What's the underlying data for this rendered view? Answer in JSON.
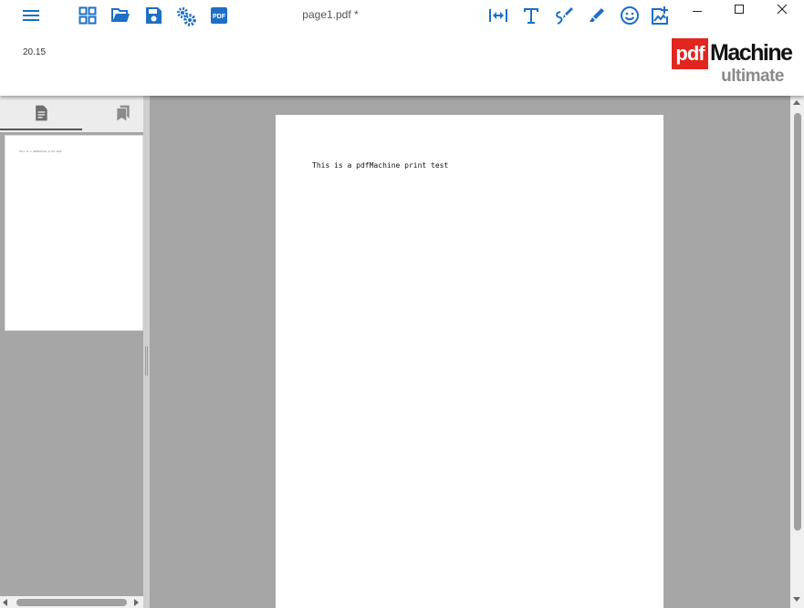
{
  "app": {
    "document_title": "page1.pdf *",
    "version": "20.15"
  },
  "logo": {
    "box_text": "pdf",
    "name": "Machine",
    "edition": "ultimate"
  },
  "toolbar": {
    "left_icons": [
      "menu-icon",
      "grid-icon",
      "folder-open-icon",
      "save-icon",
      "settings-icon",
      "pdf-icon"
    ],
    "right_icons": [
      "fit-width-icon",
      "text-icon",
      "draw-icon",
      "highlighter-icon",
      "smiley-icon",
      "add-image-icon"
    ]
  },
  "window_controls": [
    "minimize-icon",
    "maximize-icon",
    "close-icon"
  ],
  "sidebar": {
    "tabs": [
      "pages-icon",
      "bookmark-icon"
    ],
    "active_tab": "pages-icon",
    "thumbnail_text": "This is a pdfMachine print test"
  },
  "document": {
    "page_text": "This is a pdfMachine print test"
  },
  "colors": {
    "accent": "#1e6fc7",
    "logo_red": "#e0261f",
    "background_gray": "#a6a6a6"
  }
}
